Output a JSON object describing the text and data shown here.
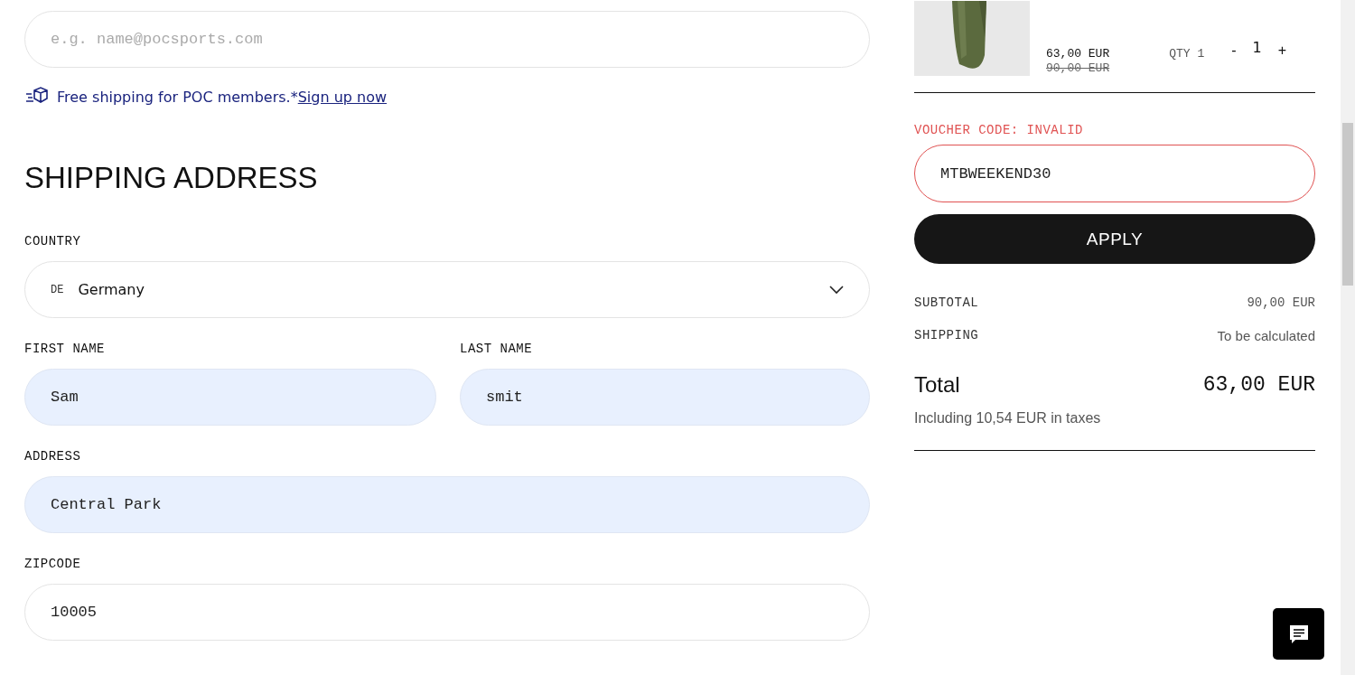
{
  "email": {
    "placeholder": "e.g. name@pocsports.com"
  },
  "shipping_note": {
    "text": "Free shipping for POC members.*",
    "link": "Sign up now"
  },
  "section_title": "SHIPPING ADDRESS",
  "country": {
    "label": "COUNTRY",
    "code": "DE",
    "value": "Germany"
  },
  "fields": [
    {
      "label": "FIRST NAME",
      "value": "Sam",
      "autofilled": true
    },
    {
      "label": "LAST NAME",
      "value": "smit",
      "autofilled": true
    },
    {
      "label": "ADDRESS",
      "value": "Central Park",
      "autofilled": true
    },
    {
      "label": "ZIPCODE",
      "value": "10005",
      "autofilled": false
    }
  ],
  "cart_item": {
    "price": "63,00 EUR",
    "old_price": "90,00 EUR",
    "qty_label": "QTY 1",
    "minus": "-",
    "qty": "1",
    "plus": "+"
  },
  "voucher": {
    "label": "VOUCHER CODE: INVALID",
    "value": "MTBWEEKEND30",
    "invalid": true,
    "button": "APPLY"
  },
  "summary": [
    {
      "label": "SUBTOTAL",
      "value": "90,00 EUR"
    },
    {
      "label": "SHIPPING",
      "value": "To be calculated"
    }
  ],
  "total": {
    "label": "Total",
    "value": "63,00 EUR",
    "taxes": "Including 10,54 EUR in taxes"
  }
}
